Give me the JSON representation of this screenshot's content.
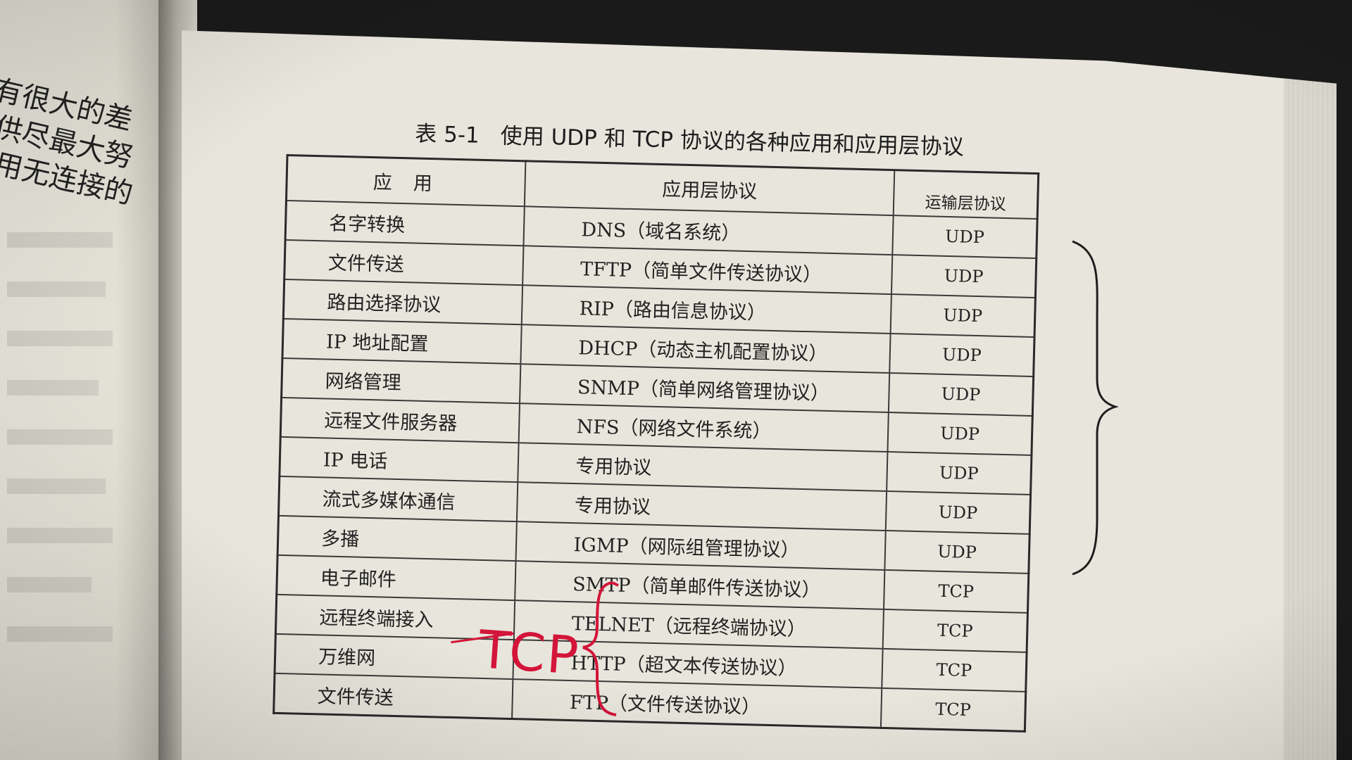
{
  "left_page": {
    "lines": [
      "有很大的差",
      "供尽最大努",
      "用无连接的"
    ]
  },
  "table": {
    "number": "表 5-1",
    "caption": "使用 UDP 和 TCP 协议的各种应用和应用层协议",
    "headers": {
      "application": "应用",
      "app_protocol": "应用层协议",
      "transport": "运输层协议"
    },
    "rows": [
      {
        "application": "名字转换",
        "app_protocol": "DNS（域名系统）",
        "transport": "UDP"
      },
      {
        "application": "文件传送",
        "app_protocol": "TFTP（简单文件传送协议）",
        "transport": "UDP"
      },
      {
        "application": "路由选择协议",
        "app_protocol": "RIP（路由信息协议）",
        "transport": "UDP"
      },
      {
        "application": "IP 地址配置",
        "app_protocol": "DHCP（动态主机配置协议）",
        "transport": "UDP"
      },
      {
        "application": "网络管理",
        "app_protocol": "SNMP（简单网络管理协议）",
        "transport": "UDP"
      },
      {
        "application": "远程文件服务器",
        "app_protocol": "NFS（网络文件系统）",
        "transport": "UDP"
      },
      {
        "application": "IP 电话",
        "app_protocol": "专用协议",
        "transport": "UDP"
      },
      {
        "application": "流式多媒体通信",
        "app_protocol": "专用协议",
        "transport": "UDP"
      },
      {
        "application": "多播",
        "app_protocol": "IGMP（网际组管理协议）",
        "transport": "UDP"
      },
      {
        "application": "电子邮件",
        "app_protocol": "SMTP（简单邮件传送协议）",
        "transport": "TCP"
      },
      {
        "application": "远程终端接入",
        "app_protocol": "TELNET（远程终端协议）",
        "transport": "TCP"
      },
      {
        "application": "万维网",
        "app_protocol": "HTTP（超文本传送协议）",
        "transport": "TCP"
      },
      {
        "application": "文件传送",
        "app_protocol": "FTP（文件传送协议）",
        "transport": "TCP"
      }
    ]
  },
  "annotations": {
    "handwritten_text": "TCP",
    "black_ink_color": "#1e1e1e",
    "red_ink_color": "#d4153a"
  },
  "colors": {
    "paper": "#e8e6dc",
    "ink": "#222222"
  }
}
